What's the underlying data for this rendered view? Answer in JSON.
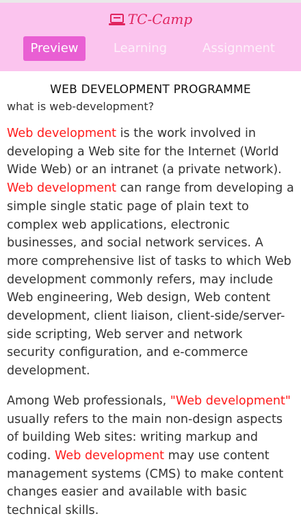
{
  "header": {
    "brand": "TC-Camp",
    "nav": [
      {
        "label": "Preview",
        "active": true
      },
      {
        "label": "Learning",
        "active": false
      },
      {
        "label": "Assignment",
        "active": false
      }
    ]
  },
  "main": {
    "title": "WEB DEVELOPMENT PROGRAMME",
    "subtitle": "what is web-development?",
    "p1": {
      "h1": "Web development",
      "t1": " is the work involved in developing a Web site for the Internet (World Wide Web) or an intranet (a private network). ",
      "h2": "Web development",
      "t2": " can range from developing a simple single static page of plain text to complex web applications, electronic businesses, and social network services. A more comprehensive list of tasks to which Web development commonly refers, may include Web engineering, Web design, Web content development, client liaison, client-side/server-side scripting, Web server and network security configuration, and e-commerce development."
    },
    "p2": {
      "t0": "Among Web professionals, ",
      "h1": "\"Web development\"",
      "t1": " usually refers to the main non-design aspects of building Web sites: writing markup and coding. ",
      "h2": "Web development",
      "t2": " may use content management systems (CMS) to make content changes easier and available with basic technical skills."
    }
  },
  "colors": {
    "header_bg": "#fbc4ee",
    "active_tab_bg": "#e95fd3",
    "brand": "#e0245e",
    "highlight": "#ff1a1a"
  },
  "icons": {
    "brand": "laptop-icon"
  }
}
